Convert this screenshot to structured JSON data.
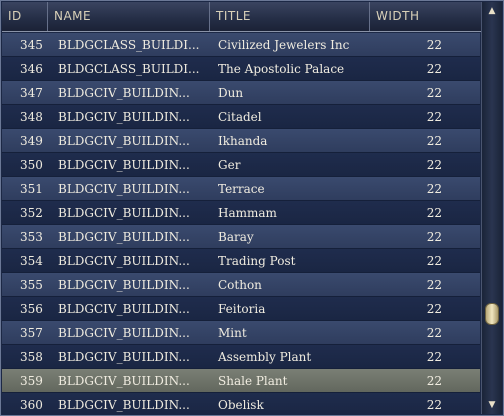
{
  "columns": {
    "id": "ID",
    "name": "NAME",
    "title": "TITLE",
    "width": "WIDTH"
  },
  "rows": [
    {
      "id": "345",
      "name": "BLDGCLASS_BUILDI...",
      "title": "Civilized Jewelers Inc",
      "width": "22"
    },
    {
      "id": "346",
      "name": "BLDGCLASS_BUILDI...",
      "title": "The Apostolic Palace",
      "width": "22"
    },
    {
      "id": "347",
      "name": "BLDGCIV_BUILDIN...",
      "title": "Dun",
      "width": "22"
    },
    {
      "id": "348",
      "name": "BLDGCIV_BUILDIN...",
      "title": "Citadel",
      "width": "22"
    },
    {
      "id": "349",
      "name": "BLDGCIV_BUILDIN...",
      "title": "Ikhanda",
      "width": "22"
    },
    {
      "id": "350",
      "name": "BLDGCIV_BUILDIN...",
      "title": "Ger",
      "width": "22"
    },
    {
      "id": "351",
      "name": "BLDGCIV_BUILDIN...",
      "title": "Terrace",
      "width": "22"
    },
    {
      "id": "352",
      "name": "BLDGCIV_BUILDIN...",
      "title": "Hammam",
      "width": "22"
    },
    {
      "id": "353",
      "name": "BLDGCIV_BUILDIN...",
      "title": "Baray",
      "width": "22"
    },
    {
      "id": "354",
      "name": "BLDGCIV_BUILDIN...",
      "title": "Trading Post",
      "width": "22"
    },
    {
      "id": "355",
      "name": "BLDGCIV_BUILDIN...",
      "title": "Cothon",
      "width": "22"
    },
    {
      "id": "356",
      "name": "BLDGCIV_BUILDIN...",
      "title": "Feitoria",
      "width": "22"
    },
    {
      "id": "357",
      "name": "BLDGCIV_BUILDIN...",
      "title": "Mint",
      "width": "22"
    },
    {
      "id": "358",
      "name": "BLDGCIV_BUILDIN...",
      "title": "Assembly Plant",
      "width": "22"
    },
    {
      "id": "359",
      "name": "BLDGCIV_BUILDIN...",
      "title": "Shale Plant",
      "width": "22",
      "selected": true
    },
    {
      "id": "360",
      "name": "BLDGCIV_BUILDIN...",
      "title": "Obelisk",
      "width": "22"
    }
  ],
  "scrollbar": {
    "up_icon": "▲",
    "down_icon": "▼"
  },
  "colors": {
    "row_odd": "#3a4a6e",
    "row_even": "#1f2c4d",
    "row_selected": "#7a7f75",
    "header_text": "#d8d0b8",
    "thumb": "#f0e6c0"
  }
}
